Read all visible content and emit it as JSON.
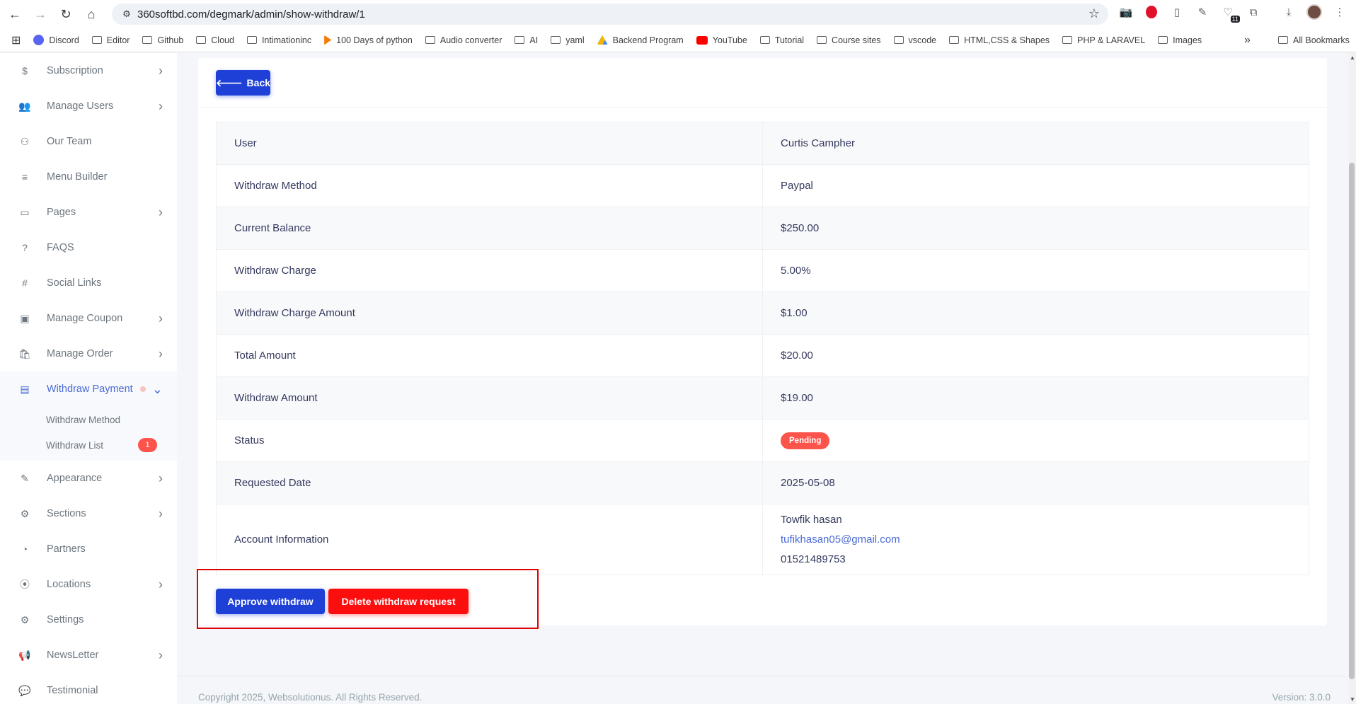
{
  "browser": {
    "url": "360softbd.com/degmark/admin/show-withdraw/1",
    "extension_badge": "11",
    "bookmarks": [
      "Discord",
      "Editor",
      "Github",
      "Cloud",
      "Intimationinc",
      "100 Days of python",
      "Audio converter",
      "AI",
      "yaml",
      "Backend Program",
      "YouTube",
      "Tutorial",
      "Course sites",
      "vscode",
      "HTML,CSS & Shapes",
      "PHP & LARAVEL",
      "Images"
    ],
    "all_bookmarks": "All Bookmarks"
  },
  "sidebar": {
    "items": [
      {
        "label": "Subscription",
        "icon": "$"
      },
      {
        "label": "Manage Users",
        "icon": "👥"
      },
      {
        "label": "Our Team",
        "icon": "⚇"
      },
      {
        "label": "Menu Builder",
        "icon": "≡"
      },
      {
        "label": "Pages",
        "icon": "▭"
      },
      {
        "label": "FAQS",
        "icon": "?"
      },
      {
        "label": "Social Links",
        "icon": "#"
      },
      {
        "label": "Manage Coupon",
        "icon": "▣"
      },
      {
        "label": "Manage Order",
        "icon": "🛍"
      },
      {
        "label": "Withdraw Payment",
        "icon": "▤"
      },
      {
        "label": "Appearance",
        "icon": "✎"
      },
      {
        "label": "Sections",
        "icon": "⚙"
      },
      {
        "label": "Partners",
        "icon": "◔"
      },
      {
        "label": "Locations",
        "icon": "⦿"
      },
      {
        "label": "Settings",
        "icon": "⚙"
      },
      {
        "label": "NewsLetter",
        "icon": "📢"
      },
      {
        "label": "Testimonial",
        "icon": "💬"
      }
    ],
    "submenu": {
      "withdraw_method": "Withdraw Method",
      "withdraw_list": "Withdraw List",
      "withdraw_list_badge": "1"
    }
  },
  "main": {
    "back_label": "Back",
    "rows": [
      {
        "label": "User",
        "value": "Curtis Campher"
      },
      {
        "label": "Withdraw Method",
        "value": "Paypal"
      },
      {
        "label": "Current Balance",
        "value": "$250.00"
      },
      {
        "label": "Withdraw Charge",
        "value": "5.00%"
      },
      {
        "label": "Withdraw Charge Amount",
        "value": "$1.00"
      },
      {
        "label": "Total Amount",
        "value": "$20.00"
      },
      {
        "label": "Withdraw Amount",
        "value": "$19.00"
      }
    ],
    "status_label": "Status",
    "status_value": "Pending",
    "requested_date_label": "Requested Date",
    "requested_date_value": "2025-05-08",
    "account_label": "Account Information",
    "account": {
      "name": "Towfik hasan",
      "email": "tufikhasan05@gmail.com",
      "phone": "01521489753"
    },
    "approve_label": "Approve withdraw",
    "delete_label": "Delete withdraw request"
  },
  "footer": {
    "copyright": "Copyright 2025, Websolutionus. All Rights Reserved.",
    "version": "Version: 3.0.0"
  },
  "colors": {
    "primary": "#1e40d7",
    "danger": "#fc0e0e",
    "pending": "#fc544b",
    "sidebar_active": "#4a6bd8"
  }
}
